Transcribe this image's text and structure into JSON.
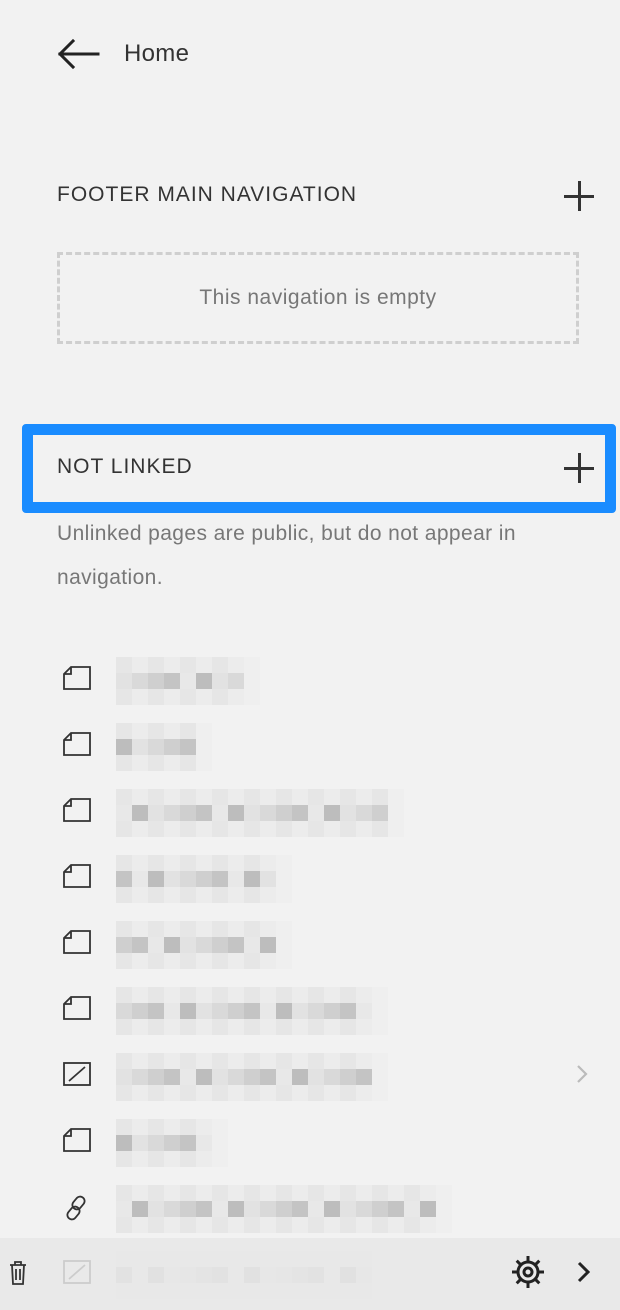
{
  "header": {
    "back_label": "Home"
  },
  "footer_nav": {
    "title": "FOOTER MAIN NAVIGATION",
    "empty_text": "This navigation is empty"
  },
  "not_linked": {
    "title": "NOT LINKED",
    "description": "Unlinked pages are public, but do not appear in navigation."
  },
  "pages": [
    {
      "icon": "page-icon"
    },
    {
      "icon": "page-icon"
    },
    {
      "icon": "page-icon"
    },
    {
      "icon": "page-icon"
    },
    {
      "icon": "page-icon"
    },
    {
      "icon": "page-icon"
    },
    {
      "icon": "disabled-page-icon",
      "has_chevron": true
    },
    {
      "icon": "page-icon"
    },
    {
      "icon": "link-icon"
    },
    {
      "icon": "disabled-page-icon"
    }
  ],
  "colors": {
    "highlight": "#1a8cff",
    "background": "#f2f2f2",
    "text": "#333333",
    "muted": "#777777"
  },
  "bottom_bar": {
    "icons": [
      "trash-icon",
      "gear-icon",
      "chevron-right-icon"
    ]
  }
}
